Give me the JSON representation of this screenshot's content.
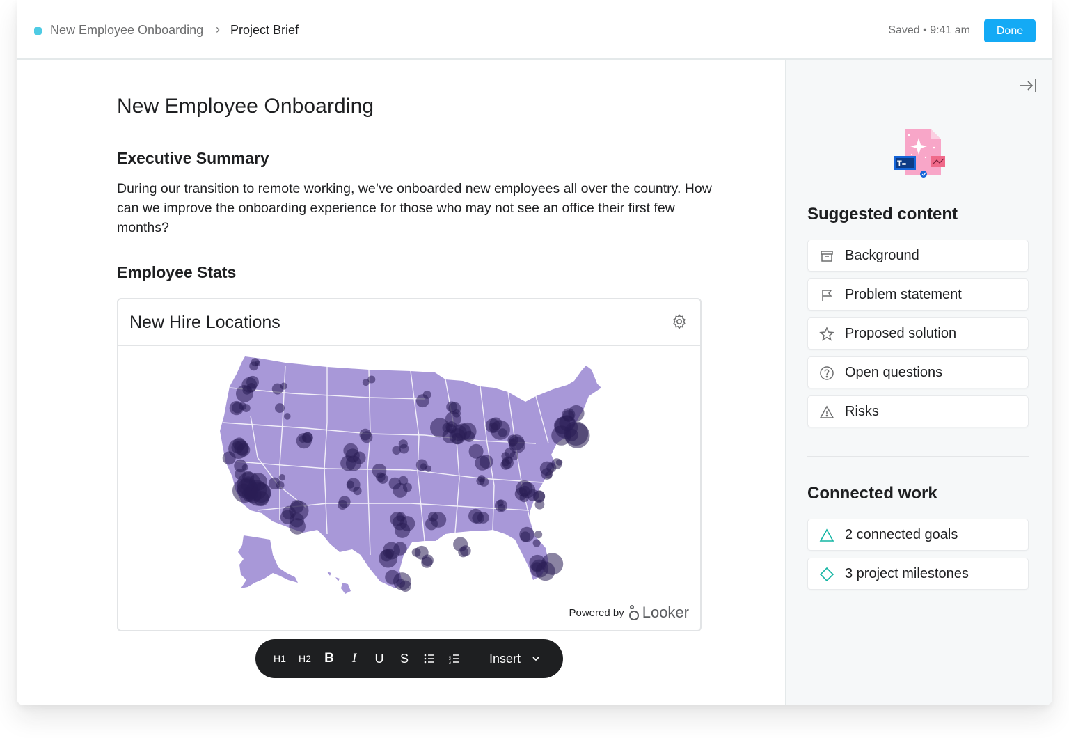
{
  "header": {
    "project_name": "New Employee Onboarding",
    "separator": "›",
    "current_page": "Project Brief",
    "saved_status": "Saved • 9:41 am",
    "done_label": "Done",
    "project_color": "#4ecbe4"
  },
  "document": {
    "title": "New Employee Onboarding",
    "sections": [
      {
        "heading": "Executive Summary",
        "body": "During our transition to remote working, we’ve onboarded new employees all over the country. How can we improve the onboarding experience for those who may not see an office their first few months?"
      },
      {
        "heading": "Employee Stats"
      }
    ],
    "widget": {
      "title": "New Hire Locations",
      "settings_icon": "gear-icon",
      "powered_by": "Powered by",
      "provider": "Looker",
      "map_colors": {
        "land": "#a898d8",
        "borders": "#ffffff",
        "marker": "#2a1d55"
      }
    }
  },
  "format_toolbar": {
    "buttons": [
      "H1",
      "H2",
      "B",
      "I",
      "U",
      "S",
      "bulleted-list",
      "numbered-list"
    ],
    "h1_label": "H1",
    "h2_label": "H2",
    "bold_label": "B",
    "italic_label": "I",
    "underline_label": "U",
    "strike_label": "S",
    "insert_label": "Insert"
  },
  "sidebar": {
    "suggested_heading": "Suggested content",
    "suggested_items": [
      {
        "label": "Background",
        "icon": "archive-box-icon"
      },
      {
        "label": "Problem statement",
        "icon": "flag-icon"
      },
      {
        "label": "Proposed solution",
        "icon": "star-icon"
      },
      {
        "label": "Open questions",
        "icon": "question-circle-icon"
      },
      {
        "label": "Risks",
        "icon": "warning-triangle-icon"
      }
    ],
    "connected_heading": "Connected work",
    "connected_items": [
      {
        "label": "2 connected goals",
        "icon": "goal-triangle-icon"
      },
      {
        "label": "3 project milestones",
        "icon": "milestone-diamond-icon"
      }
    ],
    "accent_color": "#13b5a3"
  }
}
